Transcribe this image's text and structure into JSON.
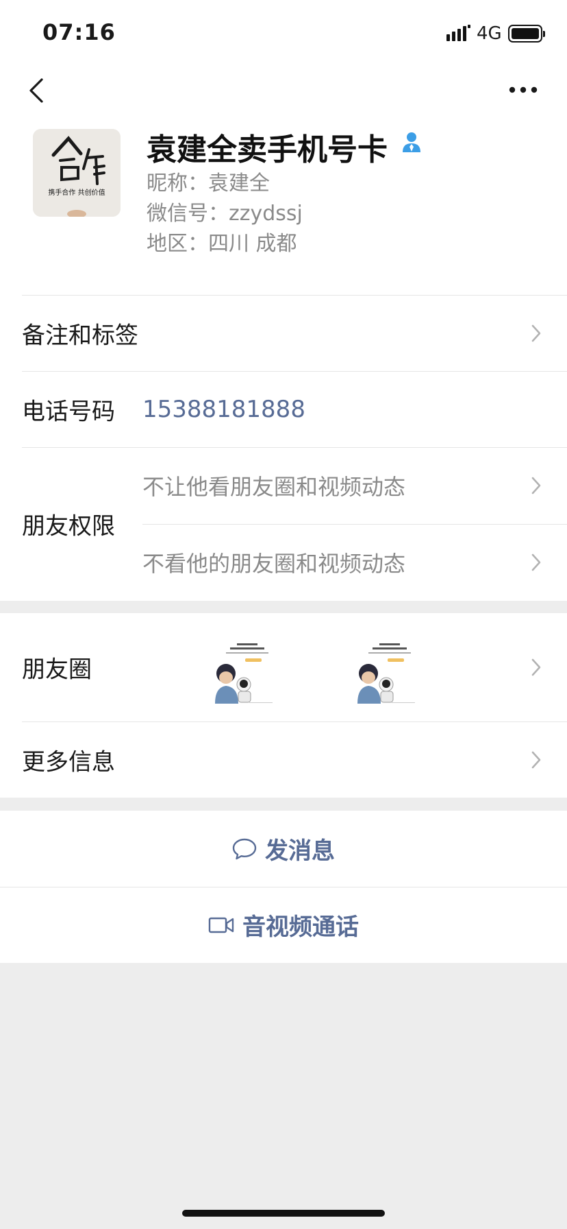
{
  "status_bar": {
    "time": "07:16",
    "network": "4G"
  },
  "profile": {
    "display_name": "袁建全卖手机号卡",
    "nickname_line": "昵称：袁建全",
    "wechat_id_line": "微信号：zzydssj",
    "region_line": "地区：四川 成都",
    "avatar_text_big": "合作",
    "avatar_text_small": "携手合作 共创价值"
  },
  "rows": {
    "remark_label": "备注和标签",
    "phone_label": "电话号码",
    "phone_value": "15388181888",
    "permission_label": "朋友权限",
    "permission_option_1": "不让他看朋友圈和视频动态",
    "permission_option_2": "不看他的朋友圈和视频动态",
    "moments_label": "朋友圈",
    "more_info_label": "更多信息"
  },
  "actions": {
    "send_message": "发消息",
    "av_call": "音视频通话"
  },
  "colors": {
    "link": "#576b95",
    "verify": "#3c9ee6"
  }
}
